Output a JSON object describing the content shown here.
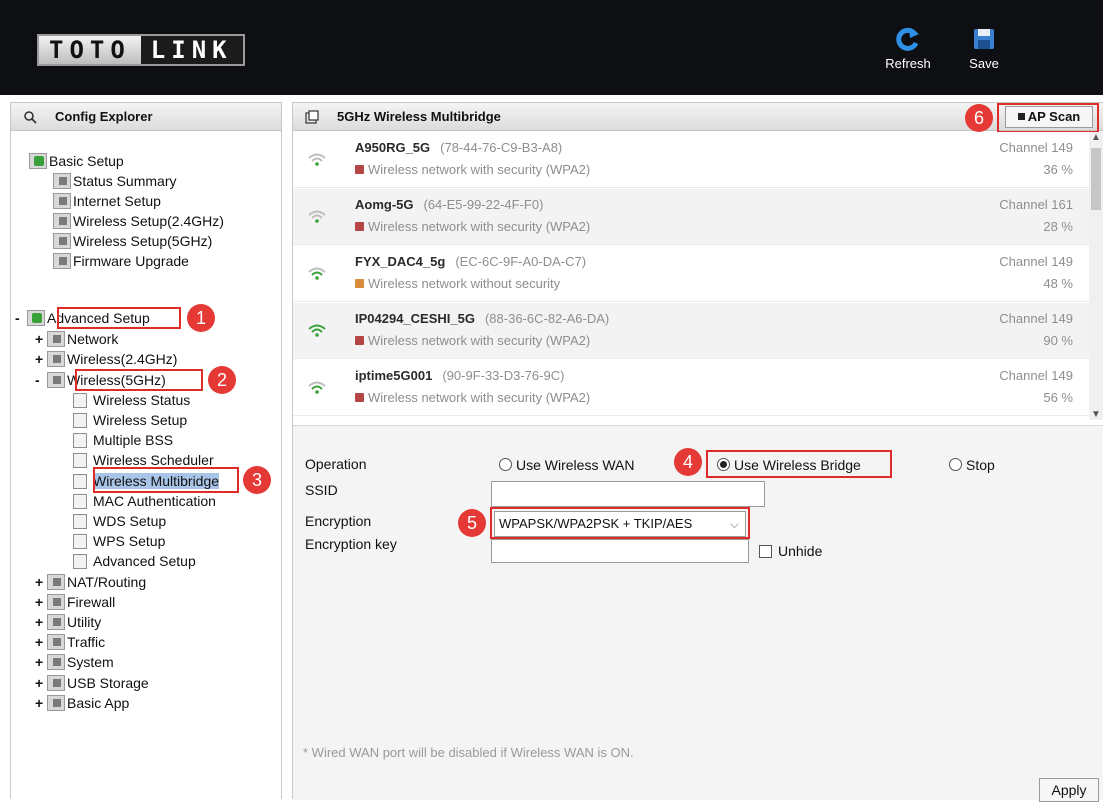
{
  "header": {
    "logo_left": "TOTO",
    "logo_right": "LINK",
    "refresh_label": "Refresh",
    "save_label": "Save"
  },
  "sidebar": {
    "title": "Config Explorer",
    "basic_setup": {
      "label": "Basic Setup",
      "items": [
        "Status Summary",
        "Internet Setup",
        "Wireless Setup(2.4GHz)",
        "Wireless Setup(5GHz)",
        "Firmware Upgrade"
      ]
    },
    "advanced_setup": {
      "label": "Advanced Setup",
      "expand": "-",
      "network": "Network",
      "wireless24": "Wireless(2.4GHz)",
      "wireless5": "Wireless(5GHz)",
      "wireless5_items": [
        "Wireless Status",
        "Wireless Setup",
        "Multiple BSS",
        "Wireless Scheduler",
        "Wireless Multibridge",
        "MAC Authentication",
        "WDS Setup",
        "WPS Setup",
        "Advanced Setup"
      ],
      "more": [
        "NAT/Routing",
        "Firewall",
        "Utility",
        "Traffic",
        "System",
        "USB Storage",
        "Basic App"
      ]
    }
  },
  "main": {
    "title": "5GHz Wireless Multibridge",
    "ap_scan_label": "AP Scan",
    "networks": [
      {
        "ssid": "A950RG_5G",
        "mac": "(78-44-76-C9-B3-A8)",
        "security": "Wireless network with security (WPA2)",
        "channel": "Channel 149",
        "signal": "36 %",
        "signal_pct": 36
      },
      {
        "ssid": "Aomg-5G",
        "mac": "(64-E5-99-22-4F-F0)",
        "security": "Wireless network with security (WPA2)",
        "channel": "Channel 161",
        "signal": "28 %",
        "signal_pct": 28
      },
      {
        "ssid": "FYX_DAC4_5g",
        "mac": "(EC-6C-9F-A0-DA-C7)",
        "security": "Wireless network without security",
        "channel": "Channel 149",
        "signal": "48 %",
        "signal_pct": 48
      },
      {
        "ssid": "IP04294_CESHI_5G",
        "mac": "(88-36-6C-82-A6-DA)",
        "security": "Wireless network with security (WPA2)",
        "channel": "Channel 149",
        "signal": "90 %",
        "signal_pct": 90
      },
      {
        "ssid": "iptime5G001",
        "mac": "(90-9F-33-D3-76-9C)",
        "security": "Wireless network with security (WPA2)",
        "channel": "Channel 149",
        "signal": "56 %",
        "signal_pct": 56
      }
    ],
    "form": {
      "operation_label": "Operation",
      "opt_wan": "Use Wireless WAN",
      "opt_bridge": "Use Wireless Bridge",
      "opt_stop": "Stop",
      "selected": "Use Wireless Bridge",
      "ssid_label": "SSID",
      "ssid_value": "",
      "encryption_label": "Encryption",
      "encryption_value": "WPAPSK/WPA2PSK + TKIP/AES",
      "key_label": "Encryption key",
      "key_value": "",
      "unhide_label": "Unhide",
      "footnote": "* Wired WAN port will be disabled if Wireless WAN is ON.",
      "apply_label": "Apply"
    }
  },
  "callouts": [
    "1",
    "2",
    "3",
    "4",
    "5",
    "6"
  ],
  "colors": {
    "accent_red": "#e53935",
    "selection": "#a8c4e6",
    "header_bg": "#0d0f12",
    "wifi_strong": "#3aa13a"
  }
}
